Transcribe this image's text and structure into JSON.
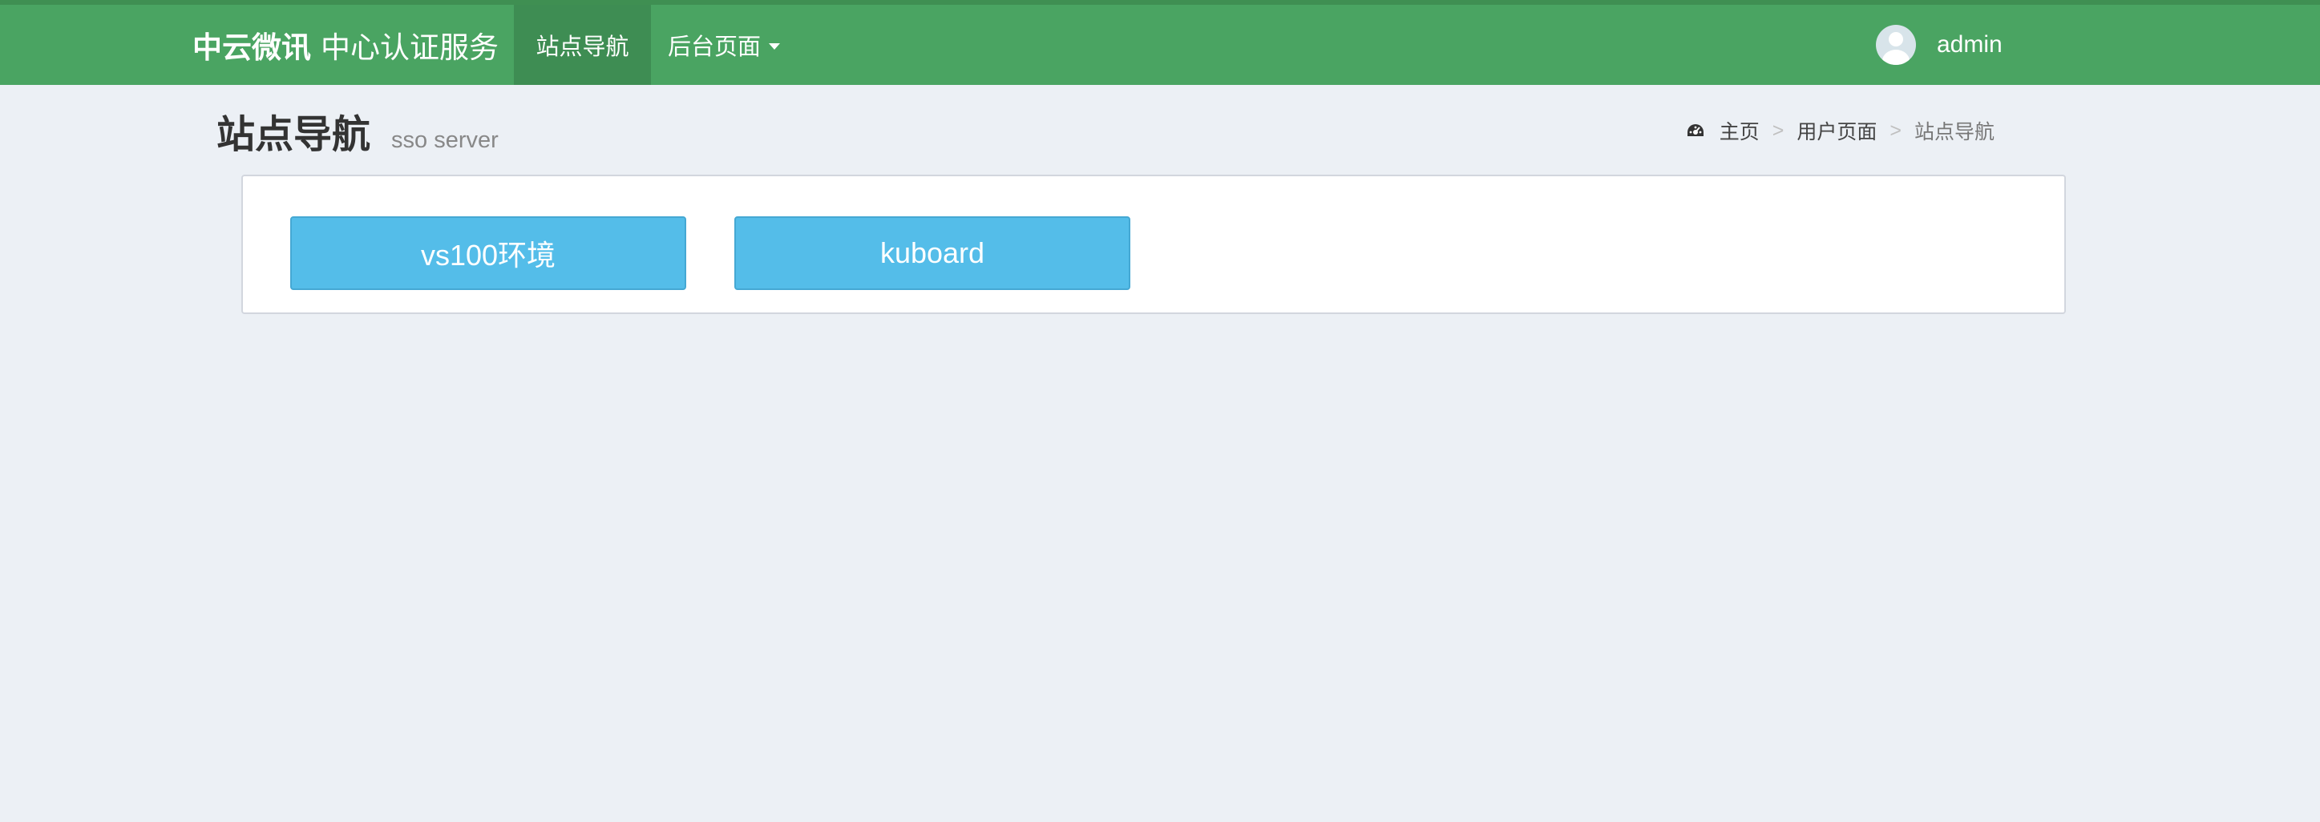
{
  "brand": {
    "name_bold": "中云微讯",
    "name_rest": "中心认证服务"
  },
  "nav": {
    "site_nav": "站点导航",
    "backend": "后台页面"
  },
  "user": {
    "name": "admin"
  },
  "page": {
    "title": "站点导航",
    "subtitle": "sso server"
  },
  "breadcrumb": {
    "home": "主页",
    "user_pages": "用户页面",
    "current": "站点导航",
    "separator": ">"
  },
  "sites": [
    {
      "label": "vs100环境"
    },
    {
      "label": "kuboard"
    }
  ],
  "colors": {
    "navbar": "#4aa462",
    "nav_active": "#3e8d53",
    "background": "#ecf0f5",
    "button": "#54bde9"
  },
  "icons": {
    "breadcrumb_home": "dashboard-icon",
    "user": "user-avatar-icon",
    "dropdown": "caret-down-icon"
  }
}
